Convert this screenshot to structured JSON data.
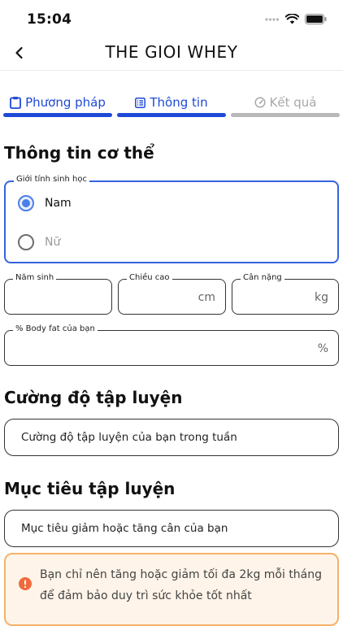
{
  "status_bar": {
    "time": "15:04"
  },
  "header": {
    "title": "THE GIOI WHEY"
  },
  "tabs": [
    {
      "label": "Phương pháp",
      "icon": "clipboard-icon",
      "state": "active"
    },
    {
      "label": "Thông tin",
      "icon": "list-icon",
      "state": "active"
    },
    {
      "label": "Kết quả",
      "icon": "gauge-icon",
      "state": "inactive"
    }
  ],
  "body_info": {
    "title": "Thông tin cơ thể",
    "gender": {
      "legend": "Giới tính sinh học",
      "options": [
        {
          "label": "Nam",
          "selected": true
        },
        {
          "label": "Nữ",
          "selected": false
        }
      ]
    },
    "birth_year": {
      "legend": "Năm sinh",
      "value": ""
    },
    "height": {
      "legend": "Chiều cao",
      "unit": "cm",
      "value": ""
    },
    "weight": {
      "legend": "Cân nặng",
      "unit": "kg",
      "value": ""
    },
    "body_fat": {
      "legend": "% Body fat của bạn",
      "unit": "%",
      "value": ""
    }
  },
  "intensity": {
    "title": "Cường độ tập luyện",
    "placeholder": "Cường độ tập luyện của bạn trong tuần"
  },
  "goal": {
    "title": "Mục tiêu tập luyện",
    "placeholder": "Mục tiêu giảm hoặc tăng cân của bạn"
  },
  "notice": {
    "text": "Bạn chỉ nên tăng hoặc giảm tối đa 2kg mỗi tháng để đảm bảo duy trì sức khỏe tốt nhất"
  },
  "colors": {
    "accent": "#1f49d6",
    "radio": "#4a7ee8",
    "notice_bg": "#fff4e9",
    "notice_border": "#f7b16b",
    "notice_icon": "#ef6a3d"
  }
}
